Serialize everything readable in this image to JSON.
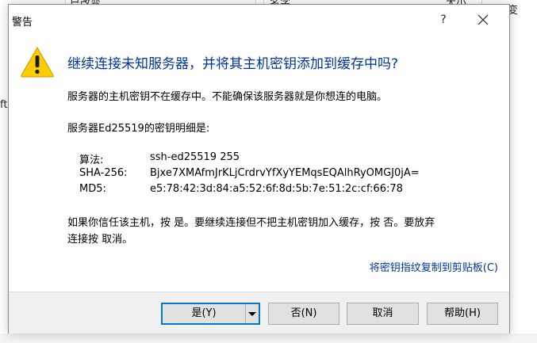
{
  "background": {
    "fragments": [
      "已改变",
      "名字",
      "大小",
      "已改变",
      "ft"
    ]
  },
  "dialog": {
    "title": "警告",
    "help_glyph": "?",
    "heading": "继续连接未知服务器，并将其主机密钥添加到缓存中吗?",
    "para1": "服务器的主机密钥不在缓存中。不能确保该服务器就是你想连的电脑。",
    "para2": "服务器Ed25519的密钥明细是:",
    "details": [
      {
        "label": "算法:",
        "value": "ssh-ed25519 255"
      },
      {
        "label": "SHA-256:",
        "value": "Bjxe7XMAfmJrKLjCrdrvYfXyYEMqsEQAlhRyOMGJ0jA="
      },
      {
        "label": "MD5:",
        "value": "e5:78:42:3d:84:a5:52:6f:8d:5b:7e:51:2c:cf:66:78"
      }
    ],
    "para3_line1": "如果你信任该主机，按 是。要继续连接但不把主机密钥加入缓存，按 否。要放弃",
    "para3_line2": "连接按 取消。",
    "copy_link": "将密钥指纹复制到剪贴板(C)",
    "buttons": {
      "yes": "是(Y)",
      "no": "否(N)",
      "cancel": "取消",
      "help": "帮助(H)"
    }
  },
  "icons": {
    "warning": "warning-triangle-icon",
    "close": "close-icon",
    "dropdown": "chevron-down-icon"
  },
  "colors": {
    "heading": "#003399",
    "link": "#003399",
    "focus_border": "#0078d7",
    "warning_fill": "#ffcc00"
  }
}
